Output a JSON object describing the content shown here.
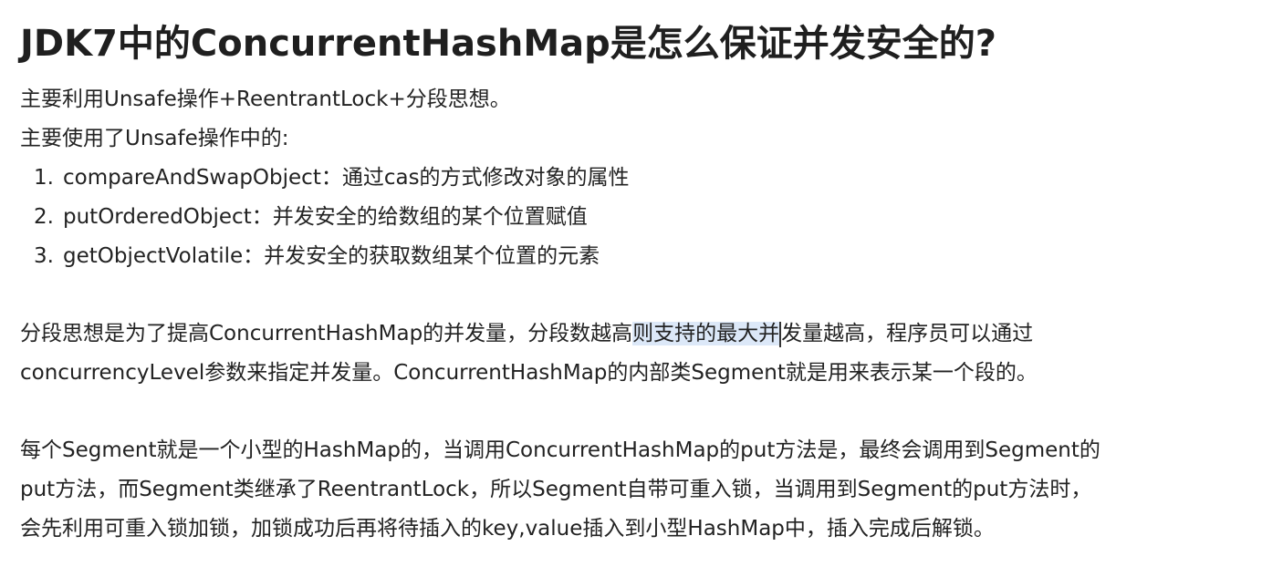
{
  "title": "JDK7中的ConcurrentHashMap是怎么保证并发安全的?",
  "intro": {
    "line1": "主要利用Unsafe操作+ReentrantLock+分段思想。",
    "line2": "主要使用了Unsafe操作中的:"
  },
  "list": [
    {
      "num": "1.",
      "text": "compareAndSwapObject：通过cas的方式修改对象的属性"
    },
    {
      "num": "2.",
      "text": "putOrderedObject：并发安全的给数组的某个位置赋值"
    },
    {
      "num": "3.",
      "text": "getObjectVolatile：并发安全的获取数组某个位置的元素"
    }
  ],
  "paragraph1": {
    "line1_before": "分段思想是为了提高ConcurrentHashMap的并发量，分段数越高",
    "line1_highlight": "则支持的最大并",
    "line1_after": "发量越高，程序员可以通过",
    "line2": "concurrencyLevel参数来指定并发量。ConcurrentHashMap的内部类Segment就是用来表示某一个段的。"
  },
  "paragraph2": {
    "line1": "每个Segment就是一个小型的HashMap的，当调用ConcurrentHashMap的put方法是，最终会调用到Segment的",
    "line2": "put方法，而Segment类继承了ReentrantLock，所以Segment自带可重入锁，当调用到Segment的put方法时，",
    "line3": "会先利用可重入锁加锁，加锁成功后再将待插入的key,value插入到小型HashMap中，插入完成后解锁。"
  },
  "colors": {
    "text": "#222222",
    "highlight": "#dce8f8",
    "background": "#ffffff"
  }
}
